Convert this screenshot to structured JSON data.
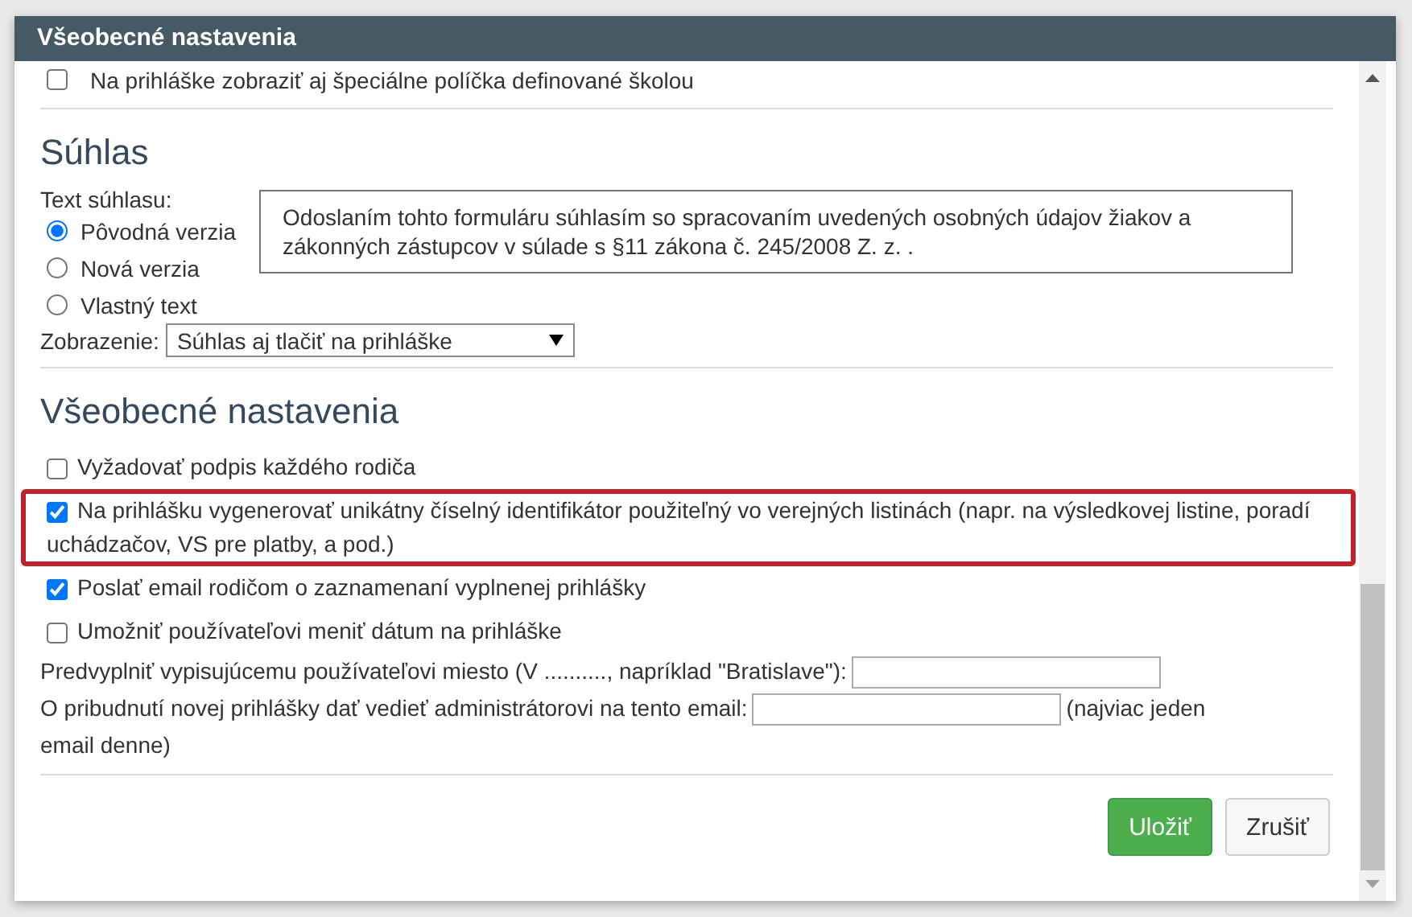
{
  "window": {
    "title": "Všeobecné nastavenia"
  },
  "top_option": {
    "label": "Na prihláške zobraziť aj špeciálne políčka definované školou",
    "checked": false
  },
  "consent": {
    "heading": "Súhlas",
    "text_label": "Text súhlasu:",
    "versions": [
      {
        "label": "Pôvodná verzia",
        "selected": true
      },
      {
        "label": "Nová verzia",
        "selected": false
      },
      {
        "label": "Vlastný text",
        "selected": false
      }
    ],
    "text": "Odoslaním tohto formuláru súhlasím so spracovaním uvedených osobných údajov žiakov a zákonných zástupcov v súlade s §11 zákona č. 245/2008 Z. z. .",
    "display_label": "Zobrazenie:",
    "display_value": "Súhlas aj tlačiť na prihláške"
  },
  "general": {
    "heading": "Všeobecné nastavenia",
    "options": [
      {
        "label": "Vyžadovať podpis každého rodiča",
        "checked": false,
        "highlighted": false
      },
      {
        "label": "Na prihlášku vygenerovať unikátny číselný identifikátor použiteľný vo verejných listinách (napr. na výsledkovej listine, poradí uchádzačov, VS pre platby, a pod.)",
        "checked": true,
        "highlighted": true
      },
      {
        "label": "Poslať email rodičom o zaznamenaní vyplnenej prihlášky",
        "checked": true,
        "highlighted": false
      },
      {
        "label": "Umožniť používateľovi meniť dátum na prihláške",
        "checked": false,
        "highlighted": false
      }
    ],
    "place_label": "Predvyplniť vypisujúcemu používateľovi miesto (V .........., napríklad \"Bratislave\"):",
    "email_label": "O pribudnutí novej prihlášky dať vedieť administrátorovi na tento email:",
    "email_note": [
      "(najviac jeden",
      "email denne)"
    ]
  },
  "buttons": {
    "save": "Uložiť",
    "cancel": "Zrušiť"
  }
}
